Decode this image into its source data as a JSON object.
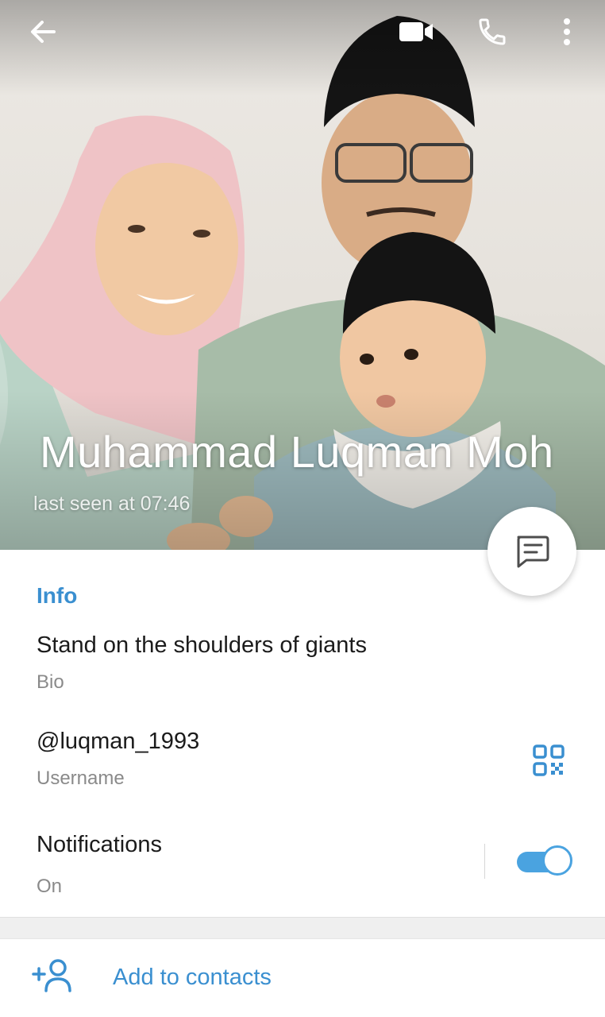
{
  "profile": {
    "name": "Muhammad Luqman Moh",
    "last_seen": "last seen at 07:46"
  },
  "header": {
    "icons": [
      "back-arrow-icon",
      "video-call-icon",
      "phone-icon",
      "more-vertical-icon"
    ]
  },
  "info": {
    "section_title": "Info",
    "bio": "Stand on the shoulders of giants",
    "bio_label": "Bio",
    "username": "@luqman_1993",
    "username_label": "Username",
    "notifications_title": "Notifications",
    "notifications_status": "On",
    "notifications_enabled": true
  },
  "actions": {
    "add_to_contacts": "Add to contacts"
  },
  "colors": {
    "accent": "#3a8fd0",
    "toggle": "#4aa3e0",
    "text_primary": "#1b1b1b",
    "text_secondary": "#8a8a8a"
  }
}
